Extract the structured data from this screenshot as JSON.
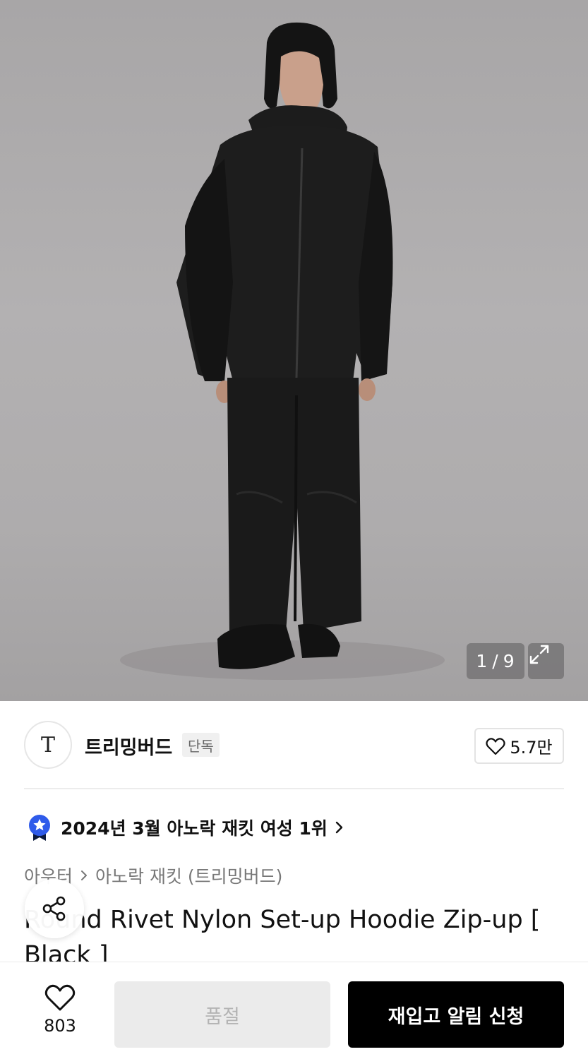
{
  "gallery": {
    "current": "1",
    "separator": "/",
    "total": "9",
    "expand_icon": "expand-icon"
  },
  "brand": {
    "logo_text": "T",
    "name": "트리밍버드",
    "badge": "단독",
    "likes": "5.7만"
  },
  "ranking": {
    "icon": "star-medal-icon",
    "text": "2024년 3월 아노락 재킷 여성 1위"
  },
  "breadcrumb": {
    "category": "아우터",
    "subcategory": "아노락 재킷 (트리밍버드)"
  },
  "product": {
    "title": "Round Rivet Nylon Set-up Hoodie Zip-up [ Black ]"
  },
  "bottom_bar": {
    "like_count": "803",
    "soldout_label": "품절",
    "restock_label": "재입고 알림 신청"
  },
  "colors": {
    "accent_blue": "#2f5bea",
    "primary_button": "#000000",
    "disabled_button": "#ebebeb"
  }
}
